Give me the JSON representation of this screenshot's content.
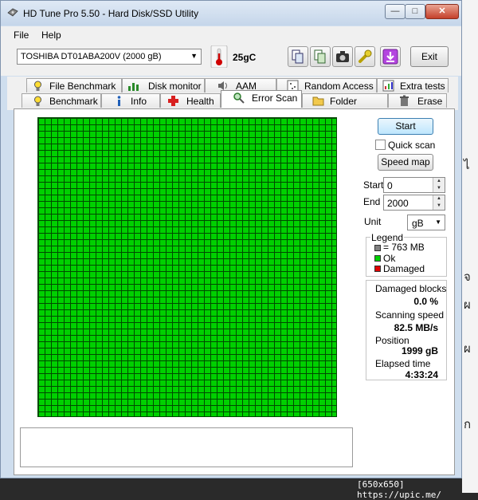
{
  "window": {
    "title": "HD Tune Pro 5.50 - Hard Disk/SSD Utility"
  },
  "caption_buttons": {
    "minimize": "—",
    "maximize": "□",
    "close": "✕"
  },
  "menu": {
    "file": "File",
    "help": "Help"
  },
  "toolbar": {
    "drive": "TOSHIBA DT01ABA200V (2000 gB)",
    "temperature": "25gC",
    "exit_label": "Exit"
  },
  "tabs": {
    "top": [
      "File Benchmark",
      "Disk monitor",
      "AAM",
      "Random Access",
      "Extra tests"
    ],
    "bottom": [
      "Benchmark",
      "Info",
      "Health",
      "Error Scan",
      "Folder Usage",
      "Erase"
    ],
    "active": "Error Scan"
  },
  "controls": {
    "start_label": "Start",
    "quick_scan_label": "Quick scan",
    "quick_scan_checked": false,
    "speed_map_label": "Speed map",
    "start_field_label": "Start",
    "start_value": "0",
    "end_field_label": "End",
    "end_value": "2000",
    "unit_label": "Unit",
    "unit_value": "gB"
  },
  "legend": {
    "title": "Legend",
    "block_size": "= 763 MB",
    "ok": "Ok",
    "damaged": "Damaged",
    "colors": {
      "block": "#808080",
      "ok": "#00d000",
      "damaged": "#e00000"
    }
  },
  "stats": {
    "damaged_blocks_label": "Damaged blocks",
    "damaged_blocks_value": "0.0 %",
    "scanning_speed_label": "Scanning speed",
    "scanning_speed_value": "82.5 MB/s",
    "position_label": "Position",
    "position_value": "1999 gB",
    "elapsed_label": "Elapsed time",
    "elapsed_value": "4:33:24"
  },
  "scan_grid": {
    "status": "all blocks Ok",
    "color": "#00d000"
  },
  "watermark": "[650x650] https://upic.me/",
  "right_strip_glyphs": [
    "ไ",
    "จ",
    "ผ",
    "ผ",
    "ก"
  ]
}
